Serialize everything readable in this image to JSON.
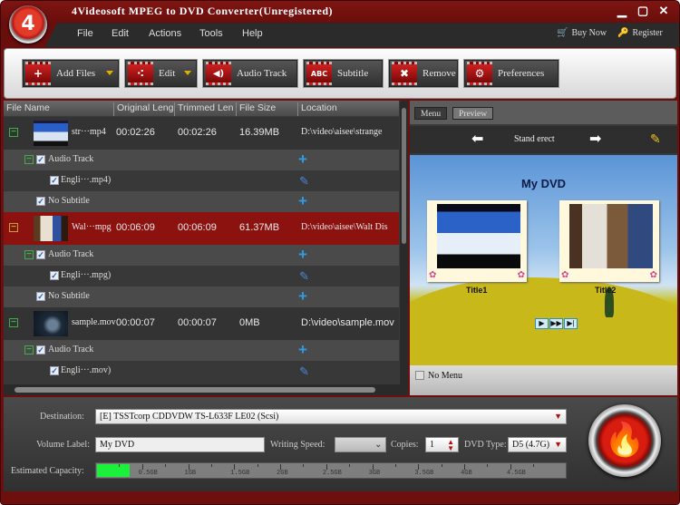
{
  "window": {
    "title": "4Videosoft MPEG to DVD Converter(Unregistered)",
    "logo_text": "4",
    "controls": {
      "minimize": "▁",
      "maximize": "▢",
      "close": "✕"
    }
  },
  "menu": {
    "items": [
      "File",
      "Edit",
      "Actions",
      "Tools",
      "Help"
    ],
    "buy_now": "Buy Now",
    "register": "Register",
    "buy_icon": "🛒",
    "register_icon": "🔑"
  },
  "toolbar": {
    "buttons": [
      {
        "label": "Add Files",
        "icon": "+",
        "dropdown": true
      },
      {
        "label": "Edit",
        "icon": "⁖",
        "dropdown": true
      },
      {
        "label": "Audio Track",
        "icon": "◀)",
        "dropdown": false
      },
      {
        "label": "Subtitle",
        "icon": "ABC",
        "dropdown": false
      },
      {
        "label": "Remove",
        "icon": "✖",
        "dropdown": false
      },
      {
        "label": "Preferences",
        "icon": "⚙",
        "dropdown": false
      }
    ]
  },
  "file_list": {
    "columns": [
      "File Name",
      "Original Leng",
      "Trimmed Len",
      "File Size",
      "Location"
    ],
    "files": [
      {
        "name": "str···mp4",
        "original": "00:02:26",
        "trimmed": "00:02:26",
        "size": "16.39MB",
        "location": "D:\\video\\aisee\\strange",
        "selected": false,
        "audio_label": "Audio Track",
        "audio_item": "Engli···.mp4)",
        "subtitle": "No Subtitle"
      },
      {
        "name": "Wal···mpg",
        "original": "00:06:09",
        "trimmed": "00:06:09",
        "size": "61.37MB",
        "location": "D:\\video\\aisee\\Walt Dis",
        "selected": true,
        "audio_label": "Audio Track",
        "audio_item": "Engli···.mpg)",
        "subtitle": "No Subtitle"
      },
      {
        "name": "sample.mov",
        "original": "00:00:07",
        "trimmed": "00:00:07",
        "size": "0MB",
        "location": "D:\\video\\sample.mov",
        "selected": false,
        "audio_label": "Audio Track",
        "audio_item": "Engli···.mov)",
        "subtitle": null
      }
    ]
  },
  "preview": {
    "tabs": [
      "Menu",
      "Preview"
    ],
    "active_tab": "Preview",
    "template_name": "Stand erect",
    "dvd_title": "My DVD",
    "titles": [
      "Title1",
      "Title2"
    ],
    "controls": [
      "▶",
      "▶▶",
      "▶|"
    ],
    "no_menu_label": "No Menu",
    "no_menu_checked": false
  },
  "bottom": {
    "destination_label": "Destination:",
    "destination_value": "[E] TSSTcorp CDDVDW TS-L633F LE02 (Scsi)",
    "volume_label": "Volume Label:",
    "volume_value": "My DVD",
    "writing_speed_label": "Writing Speed:",
    "writing_speed_value": "",
    "copies_label": "Copies:",
    "copies_value": "1",
    "dvd_type_label": "DVD Type:",
    "dvd_type_value": "D5 (4.7G)",
    "capacity_label": "Estimated Capacity:",
    "capacity_used_gb": 0.35,
    "capacity_max_gb": 5.0,
    "capacity_ticks": [
      "0.5GB",
      "1GB",
      "1.5GB",
      "2GB",
      "2.5GB",
      "3GB",
      "3.5GB",
      "4GB",
      "4.5GB"
    ],
    "capacity_color": "#1bf03a"
  },
  "colors": {
    "accent_red": "#8c1210",
    "frame_red": "#6d0f0d",
    "plus_blue": "#2f9be6",
    "toggle_green": "#3cb043"
  }
}
